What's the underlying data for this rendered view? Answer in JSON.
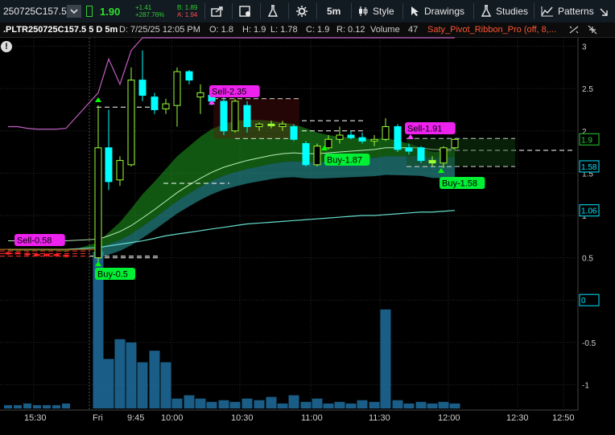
{
  "toolbar": {
    "symbol": "250725C157.5",
    "last_price": "1.90",
    "net_change": "+1.41",
    "net_change_pct": "+287.76%",
    "bid": "B: 1.89",
    "ask": "A: 1.94",
    "interval_label": "5m",
    "style_label": "Style",
    "drawings_label": "Drawings",
    "studies_label": "Studies",
    "patterns_label": "Patterns"
  },
  "infobar": {
    "symbol_desc": ".PLTR250725C157.5 5 D 5m",
    "date": "D: 7/25/25 12:05 PM",
    "open": "O: 1.8",
    "high": "H: 1.9",
    "low": "L: 1.78",
    "close": "C: 1.9",
    "range": "R: 0.12",
    "volume_label": "Volume",
    "volume_value": "47",
    "study_label": "Saty_Pivot_Ribbon_Pro (off, 8,..."
  },
  "colors": {
    "bull": "#00ffff",
    "bear": "#00ffff",
    "doji": "#9aff33",
    "ribbon_fast": "#1f9e1f",
    "ribbon_slow": "#2a9b9b",
    "ema_line": "#66ddcc",
    "pink_line": "#c060c0",
    "volume": "#1f6fa0",
    "buy_label_bg": "#00ee33",
    "sell_label_bg": "#ee22ee"
  },
  "chart_data": {
    "type": "candlestick",
    "ylim": [
      -1.3,
      3.1
    ],
    "y_ticks": [
      "3",
      "2.5",
      "2",
      "1.5",
      "1",
      "0.5",
      "0",
      "-0.5",
      "-1"
    ],
    "x_ticks": [
      "15:30",
      "Fri",
      "9:45",
      "10:00",
      "10:30",
      "11:00",
      "11:30",
      "12:00",
      "12:30",
      "12:50"
    ],
    "candles": [
      {
        "time": "15:25",
        "o": 0.56,
        "h": 0.58,
        "l": 0.53,
        "c": 0.56
      },
      {
        "time": "15:30",
        "o": 0.56,
        "h": 0.57,
        "l": 0.54,
        "c": 0.55
      },
      {
        "time": "15:35",
        "o": 0.55,
        "h": 0.57,
        "l": 0.52,
        "c": 0.54
      },
      {
        "time": "15:40",
        "o": 0.54,
        "h": 0.56,
        "l": 0.52,
        "c": 0.53
      },
      {
        "time": "15:45",
        "o": 0.53,
        "h": 0.56,
        "l": 0.51,
        "c": 0.54
      },
      {
        "time": "15:50",
        "o": 0.54,
        "h": 0.56,
        "l": 0.51,
        "c": 0.53
      },
      {
        "time": "15:55",
        "o": 0.53,
        "h": 0.55,
        "l": 0.5,
        "c": 0.52
      },
      {
        "time": "09:30",
        "o": 0.5,
        "h": 2.3,
        "l": 0.45,
        "c": 1.8
      },
      {
        "time": "09:35",
        "o": 1.8,
        "h": 2.25,
        "l": 1.3,
        "c": 1.4
      },
      {
        "time": "09:40",
        "o": 1.42,
        "h": 1.7,
        "l": 1.35,
        "c": 1.65
      },
      {
        "time": "09:45",
        "o": 1.6,
        "h": 2.75,
        "l": 1.58,
        "c": 2.6
      },
      {
        "time": "09:50",
        "o": 2.6,
        "h": 2.95,
        "l": 2.35,
        "c": 2.42
      },
      {
        "time": "09:55",
        "o": 2.4,
        "h": 2.45,
        "l": 2.2,
        "c": 2.25
      },
      {
        "time": "10:00",
        "o": 2.26,
        "h": 2.38,
        "l": 2.2,
        "c": 2.32
      },
      {
        "time": "10:05",
        "o": 2.3,
        "h": 2.75,
        "l": 2.05,
        "c": 2.7
      },
      {
        "time": "10:10",
        "o": 2.7,
        "h": 2.72,
        "l": 2.55,
        "c": 2.6
      },
      {
        "time": "10:15",
        "o": 2.4,
        "h": 2.55,
        "l": 2.2,
        "c": 2.45
      },
      {
        "time": "10:20",
        "o": 2.42,
        "h": 2.45,
        "l": 2.3,
        "c": 2.35
      },
      {
        "time": "10:25",
        "o": 2.35,
        "h": 2.4,
        "l": 1.95,
        "c": 2.0
      },
      {
        "time": "10:30",
        "o": 2.0,
        "h": 2.38,
        "l": 1.98,
        "c": 2.35
      },
      {
        "time": "10:35",
        "o": 2.3,
        "h": 2.35,
        "l": 1.98,
        "c": 2.05
      },
      {
        "time": "10:40",
        "o": 2.05,
        "h": 2.1,
        "l": 2.0,
        "c": 2.08
      },
      {
        "time": "10:45",
        "o": 2.08,
        "h": 2.12,
        "l": 2.03,
        "c": 2.06
      },
      {
        "time": "10:50",
        "o": 2.05,
        "h": 2.12,
        "l": 2.0,
        "c": 2.08
      },
      {
        "time": "10:55",
        "o": 2.05,
        "h": 2.08,
        "l": 1.88,
        "c": 1.9
      },
      {
        "time": "11:00",
        "o": 1.85,
        "h": 1.88,
        "l": 1.58,
        "c": 1.6
      },
      {
        "time": "11:05",
        "o": 1.6,
        "h": 1.85,
        "l": 1.58,
        "c": 1.82
      },
      {
        "time": "11:10",
        "o": 1.8,
        "h": 1.95,
        "l": 1.78,
        "c": 1.9
      },
      {
        "time": "11:15",
        "o": 1.9,
        "h": 2.05,
        "l": 1.85,
        "c": 1.95
      },
      {
        "time": "11:20",
        "o": 1.95,
        "h": 2.0,
        "l": 1.9,
        "c": 1.92
      },
      {
        "time": "11:25",
        "o": 1.92,
        "h": 1.98,
        "l": 1.85,
        "c": 1.88
      },
      {
        "time": "11:30",
        "o": 1.88,
        "h": 1.95,
        "l": 1.82,
        "c": 1.9
      },
      {
        "time": "11:35",
        "o": 1.9,
        "h": 2.15,
        "l": 1.88,
        "c": 2.05
      },
      {
        "time": "11:40",
        "o": 2.05,
        "h": 2.08,
        "l": 1.75,
        "c": 1.78
      },
      {
        "time": "11:45",
        "o": 1.8,
        "h": 1.85,
        "l": 1.72,
        "c": 1.76
      },
      {
        "time": "11:50",
        "o": 1.8,
        "h": 1.82,
        "l": 1.62,
        "c": 1.65
      },
      {
        "time": "11:55",
        "o": 1.65,
        "h": 1.7,
        "l": 1.58,
        "c": 1.62
      },
      {
        "time": "12:00",
        "o": 1.62,
        "h": 1.82,
        "l": 1.56,
        "c": 1.8
      },
      {
        "time": "12:05",
        "o": 1.8,
        "h": 1.9,
        "l": 1.78,
        "c": 1.9
      }
    ],
    "volume": [
      2,
      2,
      3,
      2,
      2,
      2,
      3,
      95,
      30,
      42,
      40,
      28,
      35,
      28,
      6,
      8,
      6,
      4,
      5,
      4,
      6,
      5,
      7,
      3,
      8,
      4,
      6,
      3,
      4,
      3,
      5,
      4,
      60,
      5,
      3,
      4,
      3,
      4,
      3
    ],
    "price_labels": [
      {
        "value": 1.9,
        "text": "1.9",
        "color": "#22cc33"
      },
      {
        "value": 1.58,
        "text": "1.58",
        "color": "#00e5ff"
      },
      {
        "value": 1.06,
        "text": "1.06",
        "color": "#00e5ff"
      },
      {
        "value": 0,
        "text": "0",
        "color": "#00e5ff"
      }
    ],
    "signals": [
      {
        "text": "Sell-0.58",
        "type": "sell",
        "index": 0
      },
      {
        "text": "Buy-0.5",
        "type": "buy",
        "index": 7
      },
      {
        "text": "Sell-2.35",
        "type": "sell",
        "index": 17
      },
      {
        "text": "Buy-1.87",
        "type": "buy",
        "index": 28
      },
      {
        "text": "Sell-1.91",
        "type": "sell",
        "index": 33
      },
      {
        "text": "Buy-1.58",
        "type": "buy",
        "index": 36
      }
    ]
  }
}
